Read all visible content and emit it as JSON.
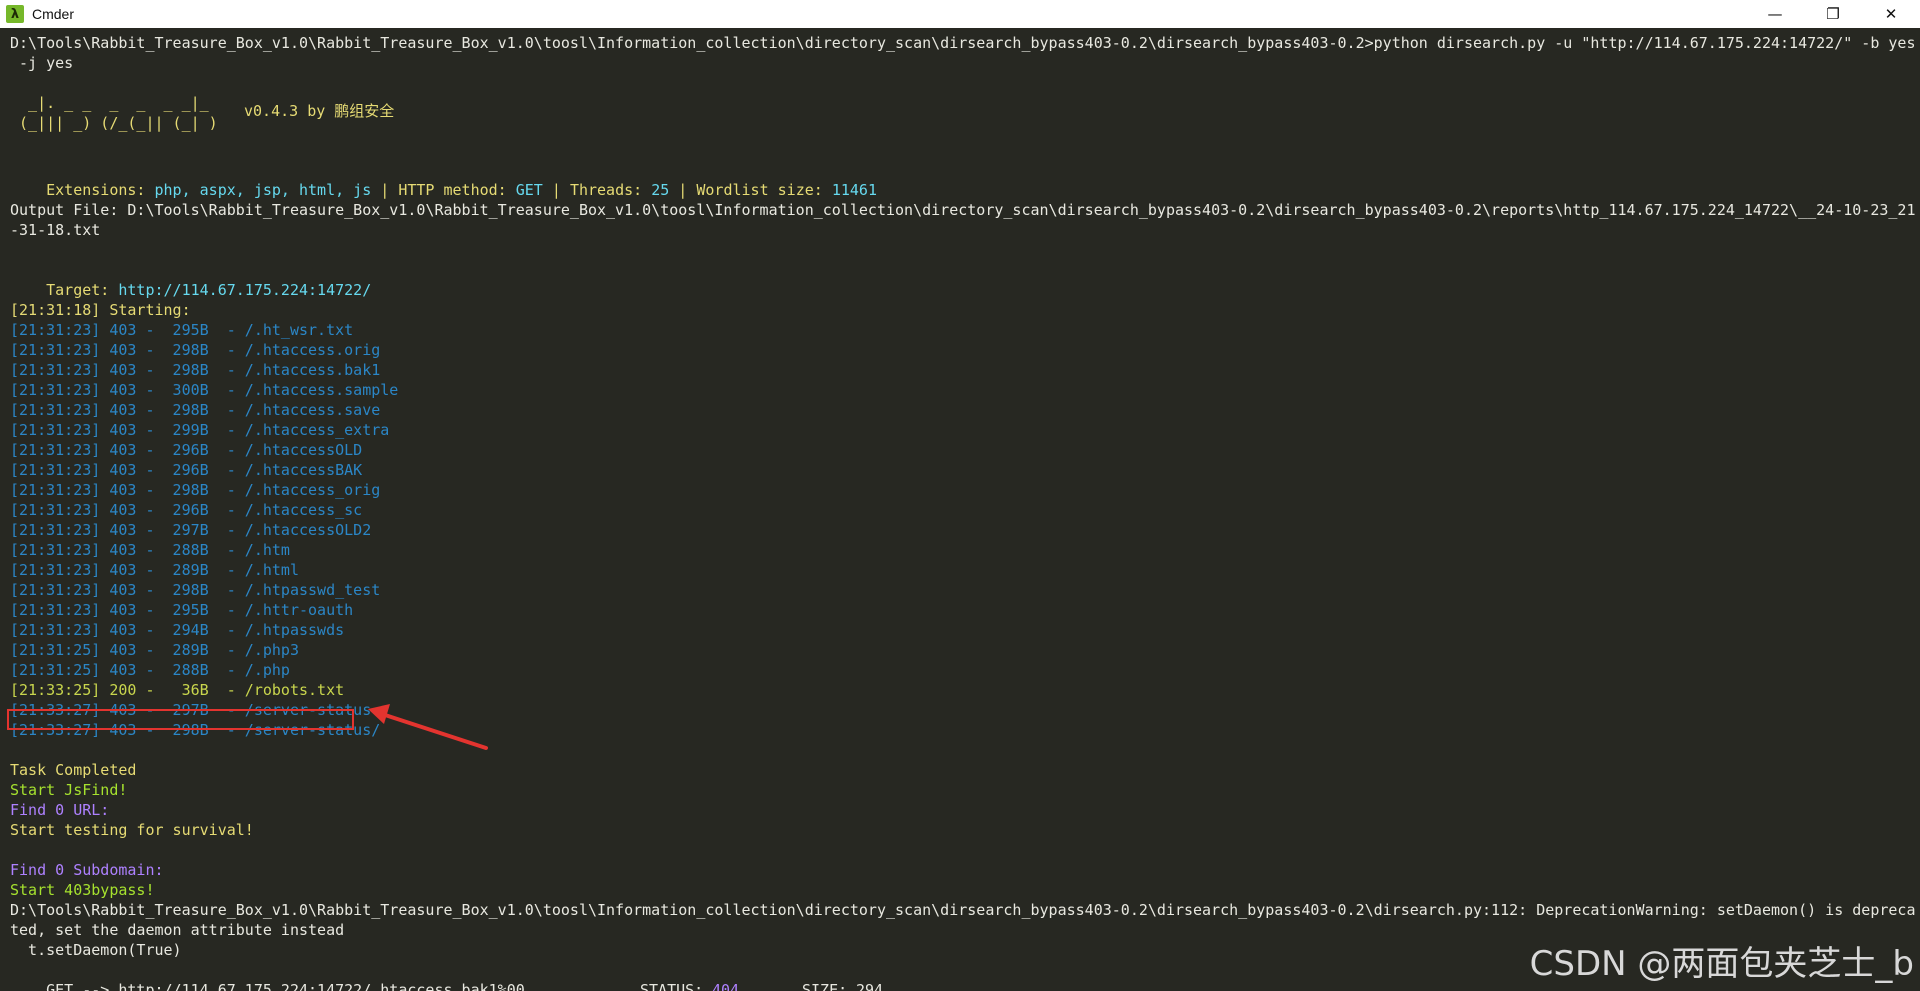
{
  "window": {
    "title": "Cmder",
    "app_icon": "λ",
    "controls": {
      "minimize": "—",
      "maximize": "❐",
      "close": "✕"
    }
  },
  "console": {
    "cmd_line_1": "D:\\Tools\\Rabbit_Treasure_Box_v1.0\\Rabbit_Treasure_Box_v1.0\\toosl\\Information_collection\\directory_scan\\dirsearch_bypass403-0.2\\dirsearch_bypass403-0.2>python dirsearch.py -u \"http://114.67.175.224:14722/\" -b yes",
    "cmd_line_2": " -j yes",
    "banner_1": "  _|. _ _  _  _  _ _|_",
    "banner_2": " (_||| _) (/_(_|| (_| )",
    "banner_version": "v0.4.3 by 鹏组安全",
    "ext_label": "Extensions: ",
    "ext_value": "php, aspx, jsp, html, js",
    "sep": " | ",
    "method_label": "HTTP method: ",
    "method_value": "GET",
    "threads_label": "Threads: ",
    "threads_value": "25",
    "wordlist_label": "Wordlist size: ",
    "wordlist_value": "11461",
    "output_line_1": "Output File: D:\\Tools\\Rabbit_Treasure_Box_v1.0\\Rabbit_Treasure_Box_v1.0\\toosl\\Information_collection\\directory_scan\\dirsearch_bypass403-0.2\\dirsearch_bypass403-0.2\\reports\\http_114.67.175.224_14722\\__24-10-23_21",
    "output_line_2": "-31-18.txt",
    "target_label": "Target: ",
    "target_value": "http://114.67.175.224:14722/",
    "starting": "[21:31:18] Starting:",
    "results": [
      "[21:31:23] 403 -  295B  - /.ht_wsr.txt",
      "[21:31:23] 403 -  298B  - /.htaccess.orig",
      "[21:31:23] 403 -  298B  - /.htaccess.bak1",
      "[21:31:23] 403 -  300B  - /.htaccess.sample",
      "[21:31:23] 403 -  298B  - /.htaccess.save",
      "[21:31:23] 403 -  299B  - /.htaccess_extra",
      "[21:31:23] 403 -  296B  - /.htaccessOLD",
      "[21:31:23] 403 -  296B  - /.htaccessBAK",
      "[21:31:23] 403 -  298B  - /.htaccess_orig",
      "[21:31:23] 403 -  296B  - /.htaccess_sc",
      "[21:31:23] 403 -  297B  - /.htaccessOLD2",
      "[21:31:23] 403 -  288B  - /.htm",
      "[21:31:23] 403 -  289B  - /.html",
      "[21:31:23] 403 -  298B  - /.htpasswd_test",
      "[21:31:23] 403 -  295B  - /.httr-oauth",
      "[21:31:23] 403 -  294B  - /.htpasswds",
      "[21:31:25] 403 -  289B  - /.php3",
      "[21:31:25] 403 -  288B  - /.php"
    ],
    "found": "[21:33:25] 200 -   36B  - /robots.txt",
    "results_after": [
      "[21:33:27] 403 -  297B  - /server-status",
      "[21:33:27] 403 -  298B  - /server-status/"
    ],
    "task_completed": "Task Completed",
    "start_jsfind": "Start JsFind!",
    "find_url": "Find 0 URL:",
    "start_testing": "Start testing for survival!",
    "find_subdomain": "Find 0 Subdomain:",
    "start_bypass": "Start 403bypass!",
    "warn_1": "D:\\Tools\\Rabbit_Treasure_Box_v1.0\\Rabbit_Treasure_Box_v1.0\\toosl\\Information_collection\\directory_scan\\dirsearch_bypass403-0.2\\dirsearch_bypass403-0.2\\dirsearch.py:112: DeprecationWarning: setDaemon() is depreca",
    "warn_2": "ted, set the daemon attribute instead",
    "warn_3": "  t.setDaemon(True)",
    "get_prefix": "GET --> http://114.67.175.224:14722/.htaccess.bak1%00",
    "status_label": "STATUS: ",
    "status_value": "404",
    "size_label": "SIZE: ",
    "size_value": "294"
  },
  "watermark": "CSDN @两面包夹芝士_b",
  "colors": {
    "background": "#272822",
    "highlight_box": "#e3342f",
    "arrow": "#e3342f",
    "result_blue": "#2b86c6"
  }
}
